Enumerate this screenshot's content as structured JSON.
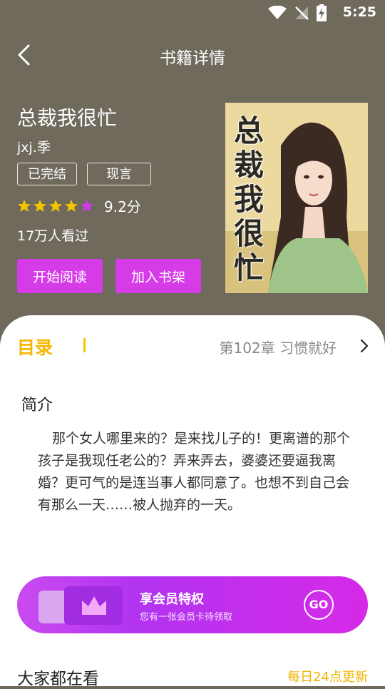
{
  "status_bar": {
    "time": "5:25"
  },
  "header": {
    "title": "书籍详情"
  },
  "book": {
    "title": "总裁我很忙",
    "author": "jxj.季",
    "tags": [
      "已完结",
      "现言"
    ],
    "rating": {
      "stars_filled": 4,
      "stars_total": 5,
      "score": "9.2分"
    },
    "views": "17万人看过",
    "cover_title": "总裁我很忙"
  },
  "actions": {
    "start_reading": "开始阅读",
    "add_to_shelf": "加入书架"
  },
  "catalog": {
    "label": "目录",
    "latest_chapter": "第102章 习惯就好"
  },
  "intro": {
    "title": "简介",
    "text": "那个女人哪里来的？是来找儿子的！更离谱的那个孩子是我现任老公的？弄来弄去，婆婆还要逼我离婚？更可气的是连当事人都同意了。也想不到自己会有那么一天……被人抛弃的一天。"
  },
  "vip": {
    "title": "享会员特权",
    "subtitle": "您有一张会员卡待领取",
    "go": "GO"
  },
  "popular": {
    "title": "大家都在看",
    "note": "每日24点更新"
  },
  "colors": {
    "accent_purple": "#d63be8",
    "accent_yellow": "#f5b700",
    "header_bg": "#6f6a5c"
  }
}
